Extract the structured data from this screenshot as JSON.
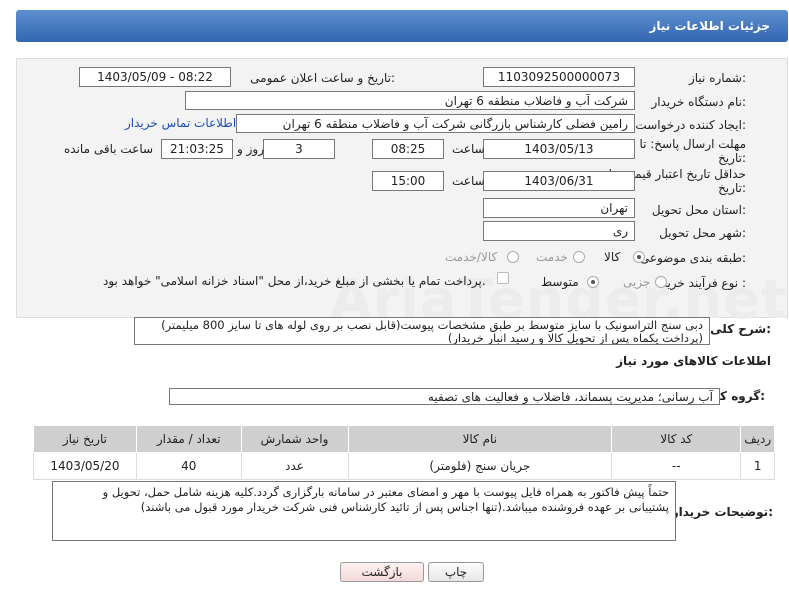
{
  "header": {
    "title": "جزئیات اطلاعات نیاز"
  },
  "fields": {
    "need_number_label": "شماره نیاز:",
    "need_number": "1103092500000073",
    "announce_label": "تاریخ و ساعت اعلان عمومی:",
    "announce_value": "1403/05/09 - 08:22",
    "buyer_org_label": "نام دستگاه خریدار:",
    "buyer_org": "شرکت آب و فاضلاب منطقه 6 تهران",
    "creator_label": "ایجاد کننده درخواست:",
    "creator": "رامین  فضلی کارشناس بازرگانی شرکت آب و فاضلاب منطقه 6 تهران",
    "contact_link": "اطلاعات تماس خریدار",
    "deadline_label_1": "مهلت ارسال پاسخ: تا",
    "deadline_label_2": "تاریخ:",
    "deadline_date": "1403/05/13",
    "time_word": "ساعت",
    "deadline_time": "08:25",
    "days_count": "3",
    "days_word": "روز و",
    "remaining_time": "21:03:25",
    "remaining_word": "ساعت باقی مانده",
    "validity_label_1": "حداقل تاریخ اعتبار قیمت: تا",
    "validity_label_2": "تاریخ:",
    "validity_date": "1403/06/31",
    "validity_time": "15:00",
    "province_label": "استان محل تحویل:",
    "province": "تهران",
    "city_label": "شهر محل تحویل:",
    "city": "ری",
    "category_label": "طبقه بندی موضوعی:",
    "category_options": [
      "کالا",
      "خدمت",
      "کالا/خدمت"
    ],
    "process_label": "نوع فرآیند خرید :",
    "process_options": [
      "جزیی",
      "متوسط"
    ],
    "payment_note": "پرداخت تمام یا بخشی از مبلغ خرید،از محل \"اسناد خزانه اسلامی\" خواهد بود."
  },
  "description": {
    "label": "شرح کلی نیاز:",
    "text": "دبی سنج التراسونیک با سایز متوسط بر طبق مشخصات پیوست(قابل نصب بر روی لوله های تا سایز 800 میلیمتر)(پرداخت یکماه پس از تحویل کالا و رسید انبار خریدار)"
  },
  "goods": {
    "section_title": "اطلاعات کالاهای مورد نیاز",
    "group_label": "گروه کالا:",
    "group_value": "آب رسانی؛ مدیریت پسماند، فاضلاب و فعالیت های تصفیه",
    "table": {
      "headers": [
        "ردیف",
        "کد کالا",
        "نام کالا",
        "واحد شمارش",
        "تعداد / مقدار",
        "تاریخ نیاز"
      ],
      "rows": [
        [
          "1",
          "--",
          "جریان سنج (فلومتر)",
          "عدد",
          "40",
          "1403/05/20"
        ]
      ]
    }
  },
  "buyer_notes": {
    "label": "توضیحات خریدار:",
    "text": "حتماً پیش فاکتور به همراه فایل پیوست با مهر و امضای معتبر در سامانه بارگزاری گردد.کلیه هزینه شامل حمل، تحویل و پشتیبانی بر عهده فروشنده میباشد.(تنها اجناس پس از تائید کارشناس فنی شرکت خریدار مورد قبول می باشند)"
  },
  "buttons": {
    "print": "چاپ",
    "back": "بازگشت"
  },
  "watermark": "AriaTender.net"
}
